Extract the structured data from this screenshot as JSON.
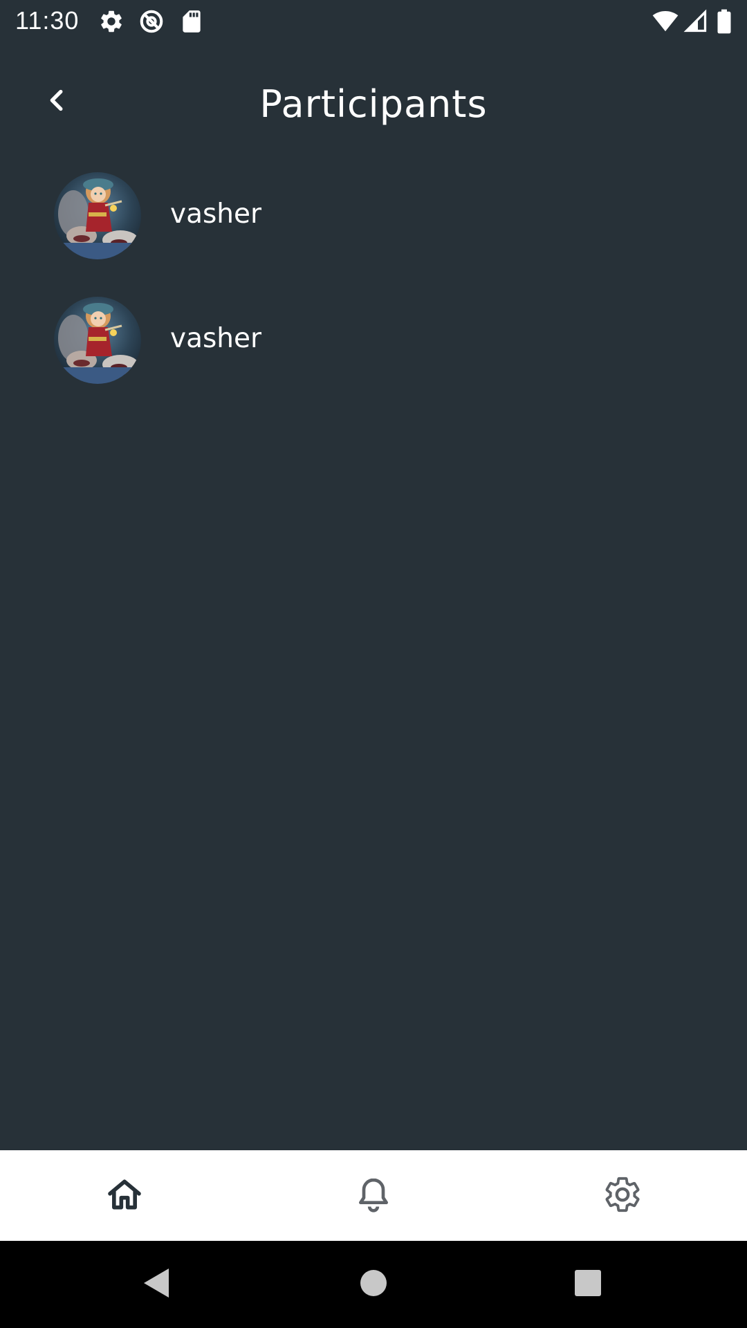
{
  "status_bar": {
    "time": "11:30",
    "left_icons": [
      "gear-icon",
      "no-sync-icon",
      "sd-card-icon"
    ],
    "right_icons": [
      "wifi-icon",
      "cell-signal-icon",
      "battery-icon"
    ]
  },
  "header": {
    "title": "Participants",
    "back_icon": "chevron-left-icon"
  },
  "participants": [
    {
      "name": "vasher",
      "avatar": "avatar-image"
    },
    {
      "name": "vasher",
      "avatar": "avatar-image"
    }
  ],
  "bottom_nav": {
    "items": [
      {
        "icon": "home-icon",
        "active": true
      },
      {
        "icon": "bell-icon",
        "active": false
      },
      {
        "icon": "settings-gear-icon",
        "active": false
      }
    ]
  },
  "system_nav": {
    "items": [
      "back-triangle-icon",
      "home-circle-icon",
      "recents-square-icon"
    ]
  },
  "colors": {
    "background": "#273138",
    "text": "#ffffff",
    "nav_background": "#ffffff",
    "nav_icon_active": "#273138",
    "nav_icon_inactive": "#5f6368",
    "system_nav_background": "#000000"
  }
}
